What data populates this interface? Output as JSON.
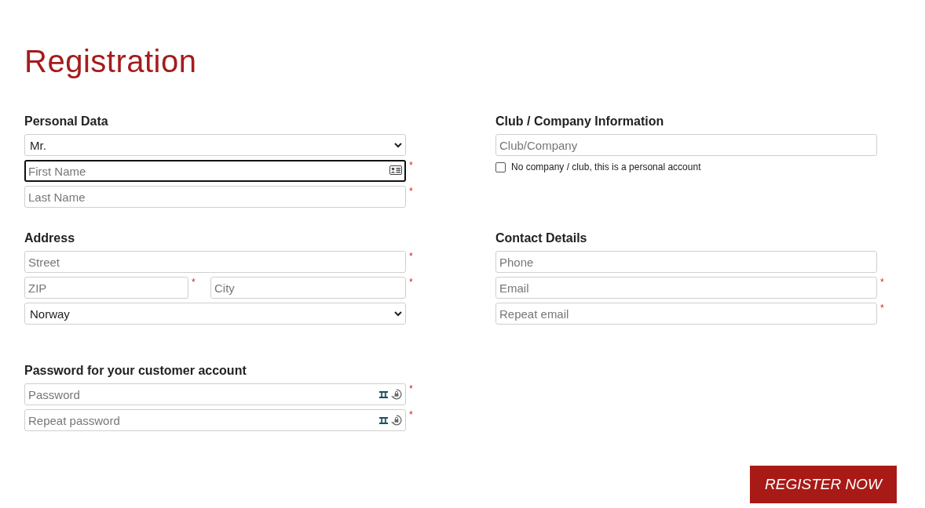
{
  "title": "Registration",
  "sections": [
    {
      "heading": "Personal Data",
      "rows": [
        [
          {
            "kind": "select",
            "value": "Mr.",
            "required": false
          }
        ],
        [
          {
            "kind": "contact-input",
            "placeholder": "First Name",
            "required": true,
            "focused": true
          }
        ],
        [
          {
            "kind": "input",
            "placeholder": "Last Name",
            "required": true,
            "focused": false
          }
        ]
      ]
    },
    {
      "heading": "Club / Company Information",
      "rows": [
        [
          {
            "kind": "input",
            "placeholder": "Club/Company",
            "required": false,
            "focused": false
          }
        ],
        [
          {
            "kind": "checkbox",
            "label": "No company / club, this is a personal account",
            "checked": false
          }
        ]
      ]
    },
    {
      "heading": "Address",
      "rows": [
        [
          {
            "kind": "input",
            "placeholder": "Street",
            "required": true,
            "focused": false
          }
        ],
        [
          {
            "kind": "input",
            "placeholder": "ZIP",
            "required": true,
            "focused": false
          },
          {
            "kind": "input",
            "placeholder": "City",
            "required": true,
            "focused": false
          }
        ],
        [
          {
            "kind": "select",
            "value": "Norway",
            "required": false
          }
        ]
      ]
    },
    {
      "heading": "Contact Details",
      "rows": [
        [
          {
            "kind": "input",
            "placeholder": "Phone",
            "required": false,
            "focused": false
          }
        ],
        [
          {
            "kind": "input",
            "placeholder": "Email",
            "required": true,
            "focused": false
          }
        ],
        [
          {
            "kind": "input",
            "placeholder": "Repeat email",
            "required": true,
            "focused": false
          }
        ]
      ]
    },
    {
      "heading": "Password for your customer account",
      "rows": [
        [
          {
            "kind": "password-input",
            "placeholder": "Password",
            "required": true,
            "focused": false
          }
        ],
        [
          {
            "kind": "password-input",
            "placeholder": "Repeat password",
            "required": true,
            "focused": false
          }
        ]
      ]
    }
  ],
  "required_mark": "*",
  "submit": "REGISTER NOW"
}
